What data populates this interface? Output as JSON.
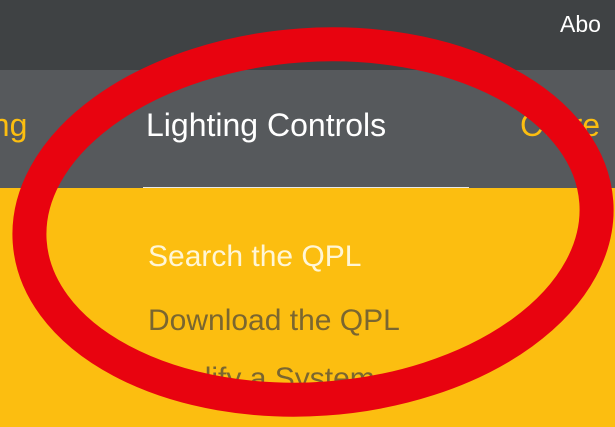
{
  "top_bar": {
    "about_link": "Abo"
  },
  "nav": {
    "items": [
      {
        "label": "hting"
      },
      {
        "label": "Lighting Controls"
      },
      {
        "label": "Curre"
      }
    ]
  },
  "dropdown": {
    "items": [
      {
        "label": "Search the QPL"
      },
      {
        "label": "Download the QPL"
      },
      {
        "label": "Qualify a System"
      }
    ]
  },
  "colors": {
    "accent": "#FCBE10",
    "nav_bg": "#56595C",
    "top_bg": "#3F4244",
    "annotation": "#E8030F"
  },
  "annotation": {
    "shape": "ellipse-outline",
    "color": "#E8030F"
  }
}
